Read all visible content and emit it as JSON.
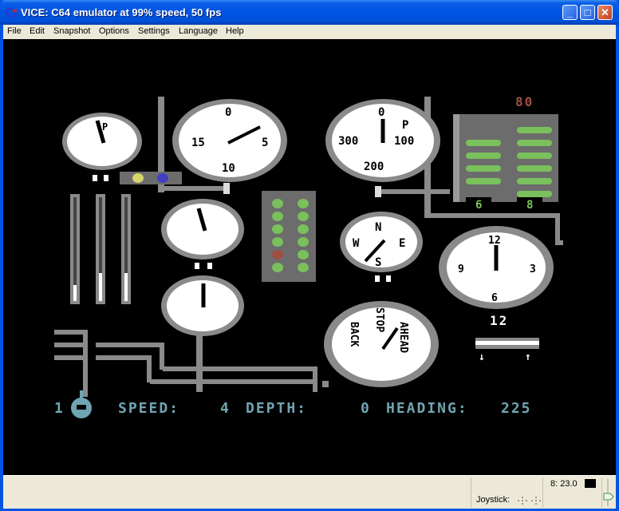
{
  "window": {
    "title": "VICE: C64 emulator at 99% speed, 50 fps",
    "controls": {
      "minimize": "_",
      "maximize": "□",
      "close": "✕"
    }
  },
  "menu": {
    "items": [
      {
        "label": "File",
        "accel": "F"
      },
      {
        "label": "Edit",
        "accel": ""
      },
      {
        "label": "Snapshot",
        "accel": ""
      },
      {
        "label": "Options",
        "accel": "O"
      },
      {
        "label": "Settings",
        "accel": "t"
      },
      {
        "label": "Language",
        "accel": "L"
      },
      {
        "label": "Help",
        "accel": "H"
      }
    ]
  },
  "game": {
    "gauges": {
      "small_top_left": {
        "labels": [
          "P"
        ]
      },
      "depth_dial": {
        "labels": [
          "0",
          "5",
          "10",
          "15"
        ]
      },
      "pressure_dial": {
        "labels": [
          "0",
          "100",
          "200",
          "300",
          "P"
        ]
      },
      "compass": {
        "labels": [
          "N",
          "E",
          "S",
          "W"
        ]
      },
      "clock": {
        "labels": [
          "12",
          "3",
          "6",
          "9"
        ],
        "readout": "12"
      },
      "telegraph": {
        "labels": [
          "BACK",
          "STOP",
          "AHEAD"
        ]
      }
    },
    "torpedo_count": "80",
    "torpedo_rack": {
      "left_count": "6",
      "right_count": "8",
      "left_loaded": 4,
      "right_loaded": 6
    },
    "indicator_panel": {
      "lights": [
        "green",
        "green",
        "green",
        "green",
        "green",
        "green",
        "green",
        "green",
        "red",
        "green",
        "green",
        "green"
      ]
    },
    "lamps": {
      "left": "#d6d66c",
      "right": "#4040c0"
    },
    "colors": {
      "status_text": "#70a4b2",
      "torpedo": "#7ac05c",
      "count": "#9f4e44",
      "pipe": "#8a8a8a",
      "panel": "#6c6c6c",
      "dial_face": "#ffffff"
    },
    "status": {
      "lives": "1",
      "speed_label": "SPEED:",
      "speed_value": "4",
      "depth_label": "DEPTH:",
      "depth_value": "0",
      "heading_label": "HEADING:",
      "heading_value": "225"
    }
  },
  "statusbar": {
    "drive_status": "8: 23.0",
    "joystick_label": "Joystick:"
  }
}
